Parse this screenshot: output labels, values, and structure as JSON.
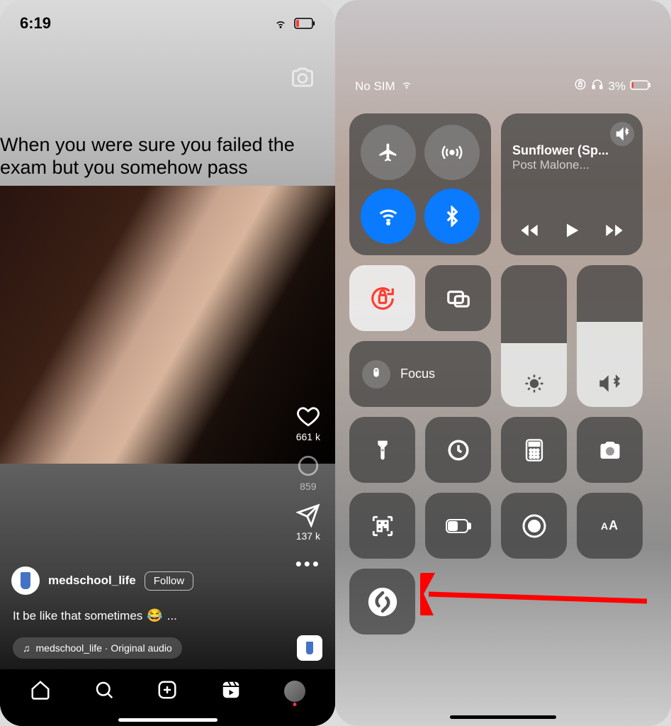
{
  "left": {
    "status": {
      "time": "6:19"
    },
    "meme_text": "When you were sure you failed the exam but you somehow pass",
    "actions": {
      "like_count": "661 k",
      "comment_count": "859",
      "share_count": "137 k"
    },
    "user": {
      "username": "medschool_life",
      "follow_label": "Follow"
    },
    "caption": "It be like that sometimes",
    "caption_suffix": "...",
    "audio": "medschool_life · Original audio"
  },
  "right": {
    "status": {
      "carrier": "No SIM",
      "battery_pct": "3%"
    },
    "media": {
      "title": "Sunflower (Sp...",
      "artist": "Post Malone..."
    },
    "focus_label": "Focus",
    "brightness_pct": 45,
    "volume_pct": 60,
    "text_size_small": "A",
    "text_size_large": "A"
  }
}
